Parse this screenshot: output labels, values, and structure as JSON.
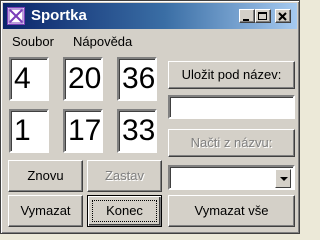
{
  "window": {
    "title": "Sportka"
  },
  "menu": {
    "file": "Soubor",
    "help": "Nápověda"
  },
  "numbers": {
    "row1": [
      "4",
      "20",
      "36"
    ],
    "row2": [
      "1",
      "17",
      "33"
    ]
  },
  "buttons": {
    "save_as": "Uložit pod název:",
    "load_from": "Načti z názvu:",
    "again": "Znovu",
    "stop": "Zastav",
    "clear": "Vymazat",
    "end": "Konec",
    "clear_all": "Vymazat vše"
  },
  "fields": {
    "save_name_value": "",
    "load_select_value": ""
  },
  "icons": {
    "app": "lottery-ticket-icon",
    "minimize": "minimize-icon",
    "maximize": "maximize-icon",
    "close": "close-icon",
    "dropdown": "chevron-down-icon"
  }
}
